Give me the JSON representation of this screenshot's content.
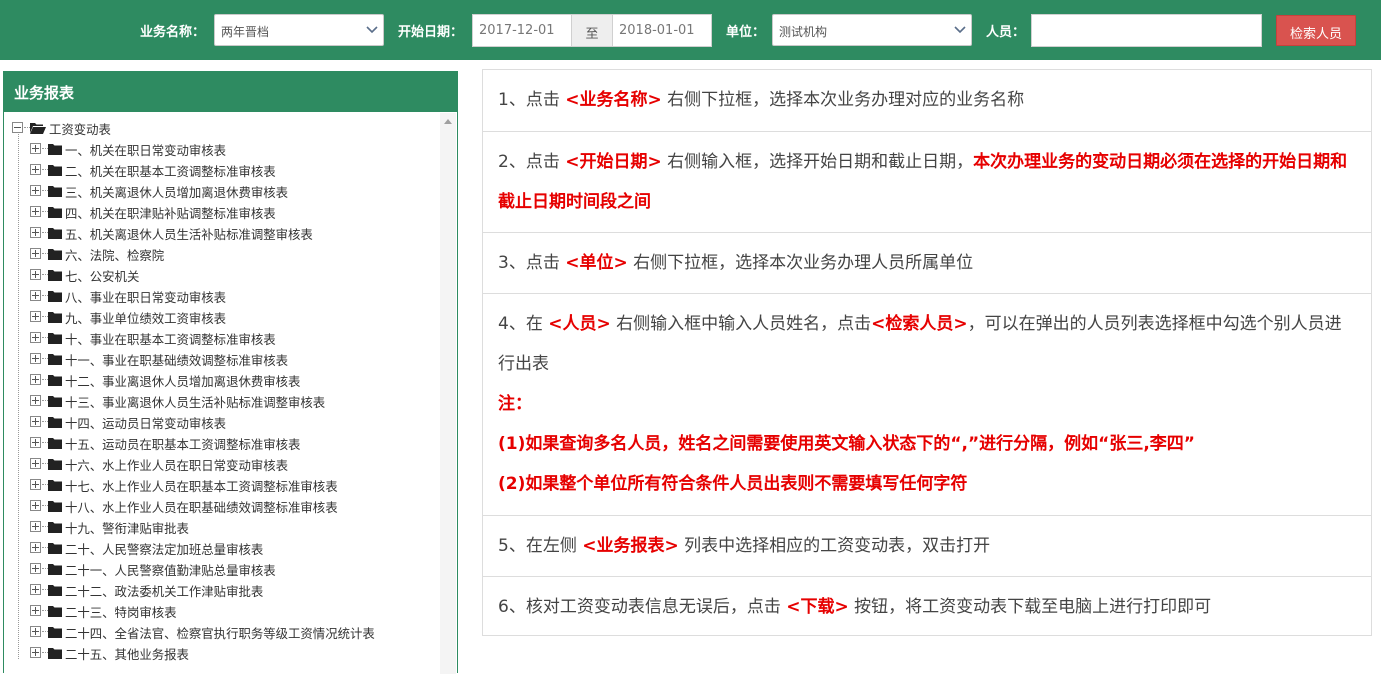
{
  "toolbar": {
    "business_name_label": "业务名称：",
    "business_name_value": "两年晋档",
    "start_date_label": "开始日期：",
    "start_date_value": "2017-12-01",
    "date_separator": "至",
    "end_date_value": "2018-01-01",
    "unit_label": "单位：",
    "unit_value": "测试机构",
    "person_label": "人员：",
    "person_value": "",
    "search_button": "检索人员"
  },
  "colors": {
    "primary_green": "#2e8b61",
    "danger_red": "#d9534f",
    "highlight_red": "#e60000"
  },
  "sidebar": {
    "title": "业务报表",
    "root": {
      "label": "工资变动表",
      "icon": "folder-open-icon"
    },
    "items": [
      "一、机关在职日常变动审核表",
      "二、机关在职基本工资调整标准审核表",
      "三、机关离退休人员增加离退休费审核表",
      "四、机关在职津贴补贴调整标准审核表",
      "五、机关离退休人员生活补贴标准调整审核表",
      "六、法院、检察院",
      "七、公安机关",
      "八、事业在职日常变动审核表",
      "九、事业单位绩效工资审核表",
      "十、事业在职基本工资调整标准审核表",
      "十一、事业在职基础绩效调整标准审核表",
      "十二、事业离退休人员增加离退休费审核表",
      "十三、事业离退休人员生活补贴标准调整审核表",
      "十四、运动员日常变动审核表",
      "十五、运动员在职基本工资调整标准审核表",
      "十六、水上作业人员在职日常变动审核表",
      "十七、水上作业人员在职基本工资调整标准审核表",
      "十八、水上作业人员在职基础绩效调整标准审核表",
      "十九、警衔津贴审批表",
      "二十、人民警察法定加班总量审核表",
      "二十一、人民警察值勤津贴总量审核表",
      "二十二、政法委机关工作津贴审批表",
      "二十三、特岗审核表",
      "二十四、全省法官、检察官执行职务等级工资情况统计表",
      "二十五、其他业务报表"
    ]
  },
  "instructions": {
    "s1": {
      "a": "1、点击 ",
      "b": "<业务名称>",
      "c": " 右侧下拉框，选择本次业务办理对应的业务名称"
    },
    "s2": {
      "a": "2、点击 ",
      "b": "<开始日期>",
      "c": " 右侧输入框，选择开始日期和截止日期，",
      "d": "本次办理业务的变动日期必须在选择的开始日期和截止日期时间段之间"
    },
    "s3": {
      "a": "3、点击 ",
      "b": "<单位>",
      "c": " 右侧下拉框，选择本次业务办理人员所属单位"
    },
    "s4": {
      "a": "4、在 ",
      "b": "<人员>",
      "c": " 右侧输入框中输入人员姓名，点击",
      "d": "<检索人员>",
      "e": "，可以在弹出的人员列表选择框中勾选个别人员进行出表",
      "note": "注：",
      "n1": "(1)如果查询多名人员，姓名之间需要使用英文输入状态下的“,”进行分隔，例如“张三,李四”",
      "n2": "(2)如果整个单位所有符合条件人员出表则不需要填写任何字符"
    },
    "s5": {
      "a": "5、在左侧 ",
      "b": "<业务报表>",
      "c": " 列表中选择相应的工资变动表，双击打开"
    },
    "s6": {
      "a": "6、核对工资变动表信息无误后，点击 ",
      "b": "<下载>",
      "c": " 按钮，将工资变动表下载至电脑上进行打印即可"
    }
  }
}
